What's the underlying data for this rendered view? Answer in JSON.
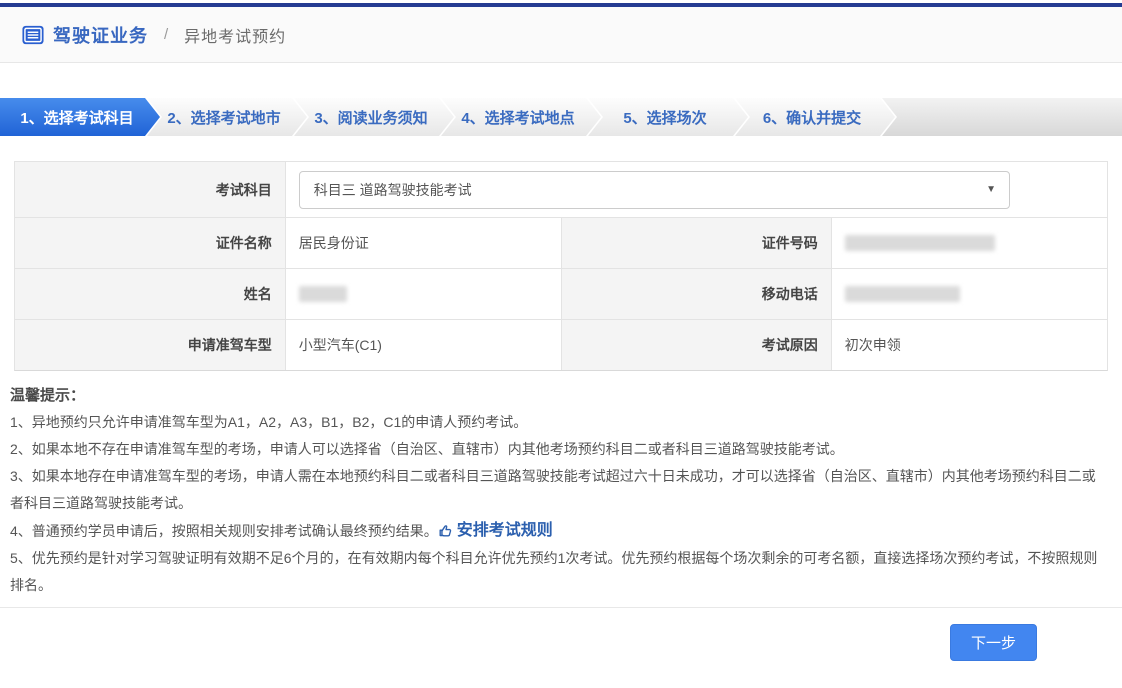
{
  "header": {
    "title": "驾驶证业务",
    "separator": "/",
    "breadcrumb": "异地考试预约"
  },
  "steps": [
    {
      "label": "1、选择考试科目",
      "active": true
    },
    {
      "label": "2、选择考试地市",
      "active": false
    },
    {
      "label": "3、阅读业务须知",
      "active": false
    },
    {
      "label": "4、选择考试地点",
      "active": false
    },
    {
      "label": "5、选择场次",
      "active": false
    },
    {
      "label": "6、确认并提交",
      "active": false
    }
  ],
  "form": {
    "subject": {
      "label": "考试科目",
      "value": "科目三 道路驾驶技能考试"
    },
    "cert_name": {
      "label": "证件名称",
      "value": "居民身份证"
    },
    "cert_no": {
      "label": "证件号码",
      "redacted": true
    },
    "name": {
      "label": "姓名",
      "redacted": true
    },
    "phone": {
      "label": "移动电话",
      "redacted": true
    },
    "vehicle": {
      "label": "申请准驾车型",
      "value": "小型汽车(C1)"
    },
    "reason": {
      "label": "考试原因",
      "value": "初次申领"
    }
  },
  "tips": {
    "title": "温馨提示：",
    "item1": "1、异地预约只允许申请准驾车型为A1，A2，A3，B1，B2，C1的申请人预约考试。",
    "item2": "2、如果本地不存在申请准驾车型的考场，申请人可以选择省（自治区、直辖市）内其他考场预约科目二或者科目三道路驾驶技能考试。",
    "item3": "3、如果本地存在申请准驾车型的考场，申请人需在本地预约科目二或者科目三道路驾驶技能考试超过六十日未成功，才可以选择省（自治区、直辖市）内其他考场预约科目二或者科目三道路驾驶技能考试。",
    "item4_text": "4、普通预约学员申请后，按照相关规则安排考试确认最终预约结果。",
    "item4_link": "安排考试规则",
    "item5": "5、优先预约是针对学习驾驶证明有效期不足6个月的，在有效期内每个科目允许优先预约1次考试。优先预约根据每个场次剩余的可考名额，直接选择场次预约考试，不按照规则排名。"
  },
  "colors": {
    "accent_blue": "#2f75e6",
    "navy_bar": "#253b92",
    "button_blue": "#4286f0",
    "link_blue": "#2b5fae"
  },
  "footer": {
    "next_label": "下一步"
  }
}
